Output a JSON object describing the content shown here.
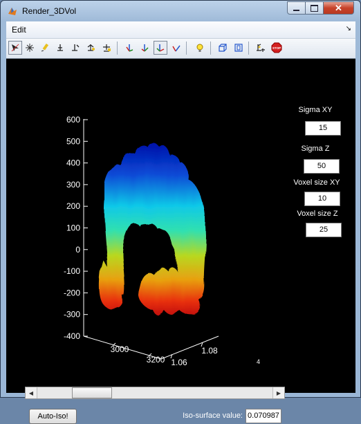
{
  "window": {
    "title": "Render_3DVol"
  },
  "menu": {
    "edit": "Edit",
    "overflow_icon": "menu-overflow-arrow"
  },
  "toolbar": {
    "tools": [
      {
        "name": "select-tool",
        "active": true
      },
      {
        "name": "zoom-region-tool"
      },
      {
        "name": "pan-tool"
      },
      {
        "name": "rotate-tool"
      },
      {
        "name": "data-cursor-tool"
      },
      {
        "name": "brush-tool"
      },
      {
        "name": "link-tool"
      },
      {
        "name": "view-x-tool"
      },
      {
        "name": "view-y-tool"
      },
      {
        "name": "view-z-tool",
        "active": true
      },
      {
        "name": "view-3d-tool"
      },
      {
        "name": "light-bulb-tool"
      },
      {
        "name": "box-view-tool"
      },
      {
        "name": "fit-view-tool"
      },
      {
        "name": "add-point-tool"
      },
      {
        "name": "stop-tool"
      }
    ]
  },
  "params": {
    "sigma_xy": {
      "label": "Sigma XY",
      "value": "15"
    },
    "sigma_z": {
      "label": "Sigma Z",
      "value": "50"
    },
    "voxel_xy": {
      "label": "Voxel size XY",
      "value": "10"
    },
    "voxel_z": {
      "label": "Voxel size Z",
      "value": "25"
    }
  },
  "axes": {
    "z_ticks": [
      "600",
      "500",
      "400",
      "300",
      "200",
      "100",
      "0",
      "-100",
      "-200",
      "-300",
      "-400"
    ],
    "x_ticks": [
      "3000",
      "3200"
    ],
    "y_ticks": [
      "1.06",
      "1.08"
    ],
    "y_exponent": "4"
  },
  "controls": {
    "auto_iso": "Auto-Iso!",
    "iso_label": "Iso-surface value:",
    "iso_value": "0.070987",
    "slider_fraction": 0.18
  },
  "colors": {
    "accent_red": "#c7422a",
    "plot_bg": "#000000"
  }
}
